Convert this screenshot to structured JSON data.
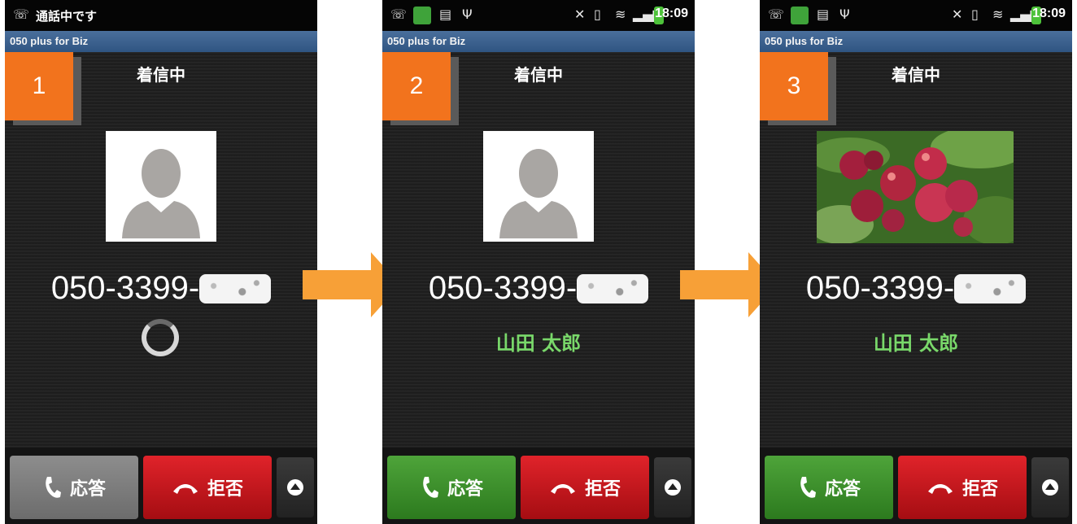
{
  "app": {
    "title": "050 plus for Biz"
  },
  "colors": {
    "accent_orange": "#f2731d",
    "name_green": "#79d86a",
    "answer_green": "#3e8f2b",
    "reject_red": "#c8171d",
    "arrow_orange": "#f7a037"
  },
  "screens": [
    {
      "step": "1",
      "status_text": "通話中です",
      "clock": "",
      "incoming_label": "着信中",
      "number": "050-3399-",
      "contact_name": "",
      "avatar": "person-placeholder-icon",
      "answer_label": "応答",
      "reject_label": "拒否"
    },
    {
      "step": "2",
      "status_text": "",
      "clock": "18:09",
      "incoming_label": "着信中",
      "number": "050-3399-",
      "contact_name": "山田 太郎",
      "avatar": "person-placeholder-icon",
      "answer_label": "応答",
      "reject_label": "拒否"
    },
    {
      "step": "3",
      "status_text": "",
      "clock": "18:09",
      "incoming_label": "着信中",
      "number": "050-3399-",
      "contact_name": "山田 太郎",
      "avatar": "apple-photo",
      "answer_label": "応答",
      "reject_label": "拒否"
    }
  ]
}
